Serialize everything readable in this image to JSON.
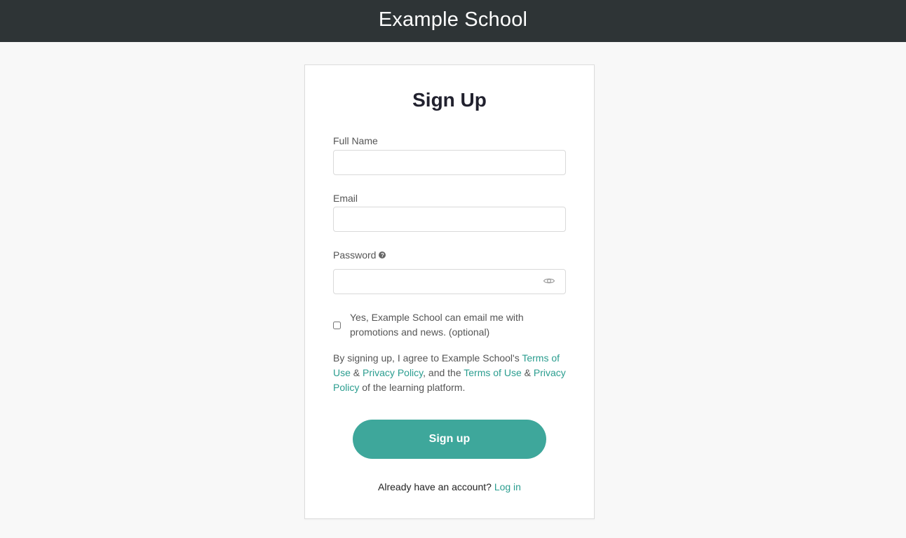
{
  "header": {
    "title": "Example School"
  },
  "form": {
    "title": "Sign Up",
    "full_name": {
      "label": "Full Name",
      "value": "",
      "placeholder": ""
    },
    "email": {
      "label": "Email",
      "value": "",
      "placeholder": ""
    },
    "password": {
      "label": "Password",
      "value": "",
      "placeholder": "",
      "help_icon": "question-circle-icon",
      "toggle_icon": "eye-icon"
    },
    "marketing_opt_in": {
      "label": "Yes, Example School can email me with promotions and news. (optional)",
      "checked": false
    },
    "terms": {
      "text_1": "By signing up, I agree to Example School's ",
      "link_1": "Terms of Use",
      "text_2": " & ",
      "link_2": "Privacy Policy",
      "text_3": ", and the ",
      "link_3": "Terms of Use",
      "text_4": " & ",
      "link_4": "Privacy Policy",
      "text_5": " of the learning platform."
    },
    "submit_label": "Sign up",
    "login_prompt": "Already have an account?",
    "login_link": "Log in"
  },
  "colors": {
    "header_bg": "#2e3436",
    "accent": "#3ea79b",
    "link": "#2a9d8f",
    "page_bg": "#f8f8f8"
  }
}
